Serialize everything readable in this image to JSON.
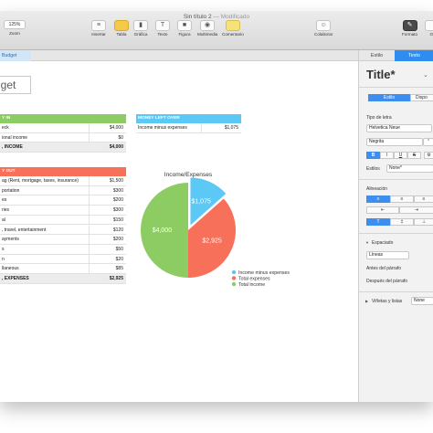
{
  "window": {
    "title": "Sin título 2",
    "title_separator": "—",
    "modified": "Modificado",
    "zoom": "125%"
  },
  "toolbar": {
    "zoom_label": "Zoom",
    "insert_label": "Insertar",
    "table_label": "Tabla",
    "chart_label": "Gráfica",
    "text_label": "Texto",
    "shape_label": "Figura",
    "media_label": "Multimedia",
    "comment_label": "Comentario",
    "collaborate_label": "Colaborar",
    "format_label": "Formato",
    "organize_label": "Or"
  },
  "sheet": {
    "tab_label": "Budget",
    "title": "dget"
  },
  "money_in": {
    "header": "Y IN",
    "rows": [
      {
        "label": "eck",
        "value": "$4,000"
      },
      {
        "label": "ional income",
        "value": "$0"
      }
    ],
    "total": {
      "label": ", INCOME",
      "value": "$4,000"
    }
  },
  "money_left": {
    "header": "MONEY LEFT OVER",
    "row": {
      "label": "Income minus expenses",
      "value": "$1,075"
    }
  },
  "money_out": {
    "header": "Y OUT",
    "rows": [
      {
        "label": "ag (Rent, mortgage, taxes, insurance)",
        "value": "$1,500"
      },
      {
        "label": "portation",
        "value": "$300"
      },
      {
        "label": "es",
        "value": "$200"
      },
      {
        "label": "ries",
        "value": "$300"
      },
      {
        "label": "al",
        "value": "$150"
      },
      {
        "label": ", travel, entertainment",
        "value": "$120"
      },
      {
        "label": "ayments",
        "value": "$200"
      },
      {
        "label": "s",
        "value": "$50"
      },
      {
        "label": "n",
        "value": "$20"
      },
      {
        "label": "llaneous",
        "value": "$85"
      }
    ],
    "total": {
      "label": ", EXPENSES",
      "value": "$2,925"
    }
  },
  "chart_data": {
    "type": "pie",
    "title": "Income/Expenses",
    "categories": [
      "Income minus expenses",
      "Total expenses",
      "Total income"
    ],
    "values": [
      1075,
      2925,
      4000
    ],
    "data_labels": [
      "$1,075",
      "$2,925",
      "$4,000"
    ],
    "colors": [
      "#5bc8f5",
      "#f7705a",
      "#8ccc63"
    ],
    "legend_position": "bottom-right"
  },
  "colors": {
    "green": "#8ccc63",
    "blue": "#5bc8f5",
    "red": "#f7705a",
    "accent": "#2d8ef0"
  },
  "inspector": {
    "tab_style": "Estilo",
    "tab_text": "Texto",
    "para_style": "Title*",
    "seg_style": "Estilo",
    "seg_layout": "Dispo",
    "font_label": "Tipo de letra",
    "font_name": "Helvetica Neue",
    "font_weight": "Negrita",
    "bold": "B",
    "italic": "I",
    "underline": "U",
    "strike": "S",
    "styles_label": "Estilos",
    "styles_value": "None*",
    "alignment_label": "Alineación",
    "spacing_label": "Espaciado",
    "spacing_value": "Líneas",
    "before_label": "Antes del párrafo",
    "after_label": "Después del párrafo",
    "bullets_label": "Viñetas y listas",
    "bullets_value": "None"
  }
}
